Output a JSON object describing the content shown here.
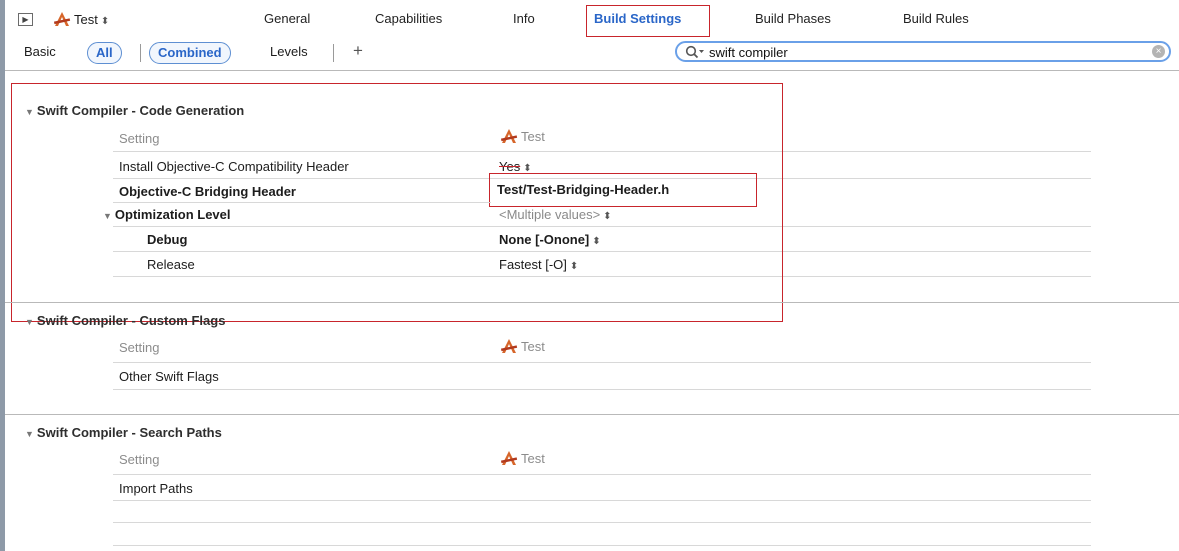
{
  "header": {
    "target_name": "Test",
    "tabs": [
      {
        "label": "General"
      },
      {
        "label": "Capabilities"
      },
      {
        "label": "Info"
      },
      {
        "label": "Build Settings"
      },
      {
        "label": "Build Phases"
      },
      {
        "label": "Build Rules"
      }
    ]
  },
  "filters": {
    "basic": "Basic",
    "all": "All",
    "combined": "Combined",
    "levels": "Levels",
    "add": "+"
  },
  "search": {
    "value": "swift compiler"
  },
  "sections": [
    {
      "title": "Swift Compiler - Code Generation",
      "column_setting": "Setting",
      "column_target": "Test",
      "rows": [
        {
          "name": "Install Objective-C Compatibility Header",
          "value": "Yes"
        },
        {
          "name": "Objective-C Bridging Header",
          "value": "Test/Test-Bridging-Header.h"
        },
        {
          "name": "Optimization Level",
          "value": "<Multiple values>"
        },
        {
          "name": "Debug",
          "value": "None [-Onone]"
        },
        {
          "name": "Release",
          "value": "Fastest [-O]"
        }
      ]
    },
    {
      "title": "Swift Compiler - Custom Flags",
      "column_setting": "Setting",
      "column_target": "Test",
      "rows": [
        {
          "name": "Other Swift Flags",
          "value": ""
        }
      ]
    },
    {
      "title": "Swift Compiler - Search Paths",
      "column_setting": "Setting",
      "column_target": "Test",
      "rows": [
        {
          "name": "Import Paths",
          "value": ""
        }
      ]
    }
  ],
  "colors": {
    "highlight_box": "#c8252c",
    "accent": "#2a66c8"
  }
}
